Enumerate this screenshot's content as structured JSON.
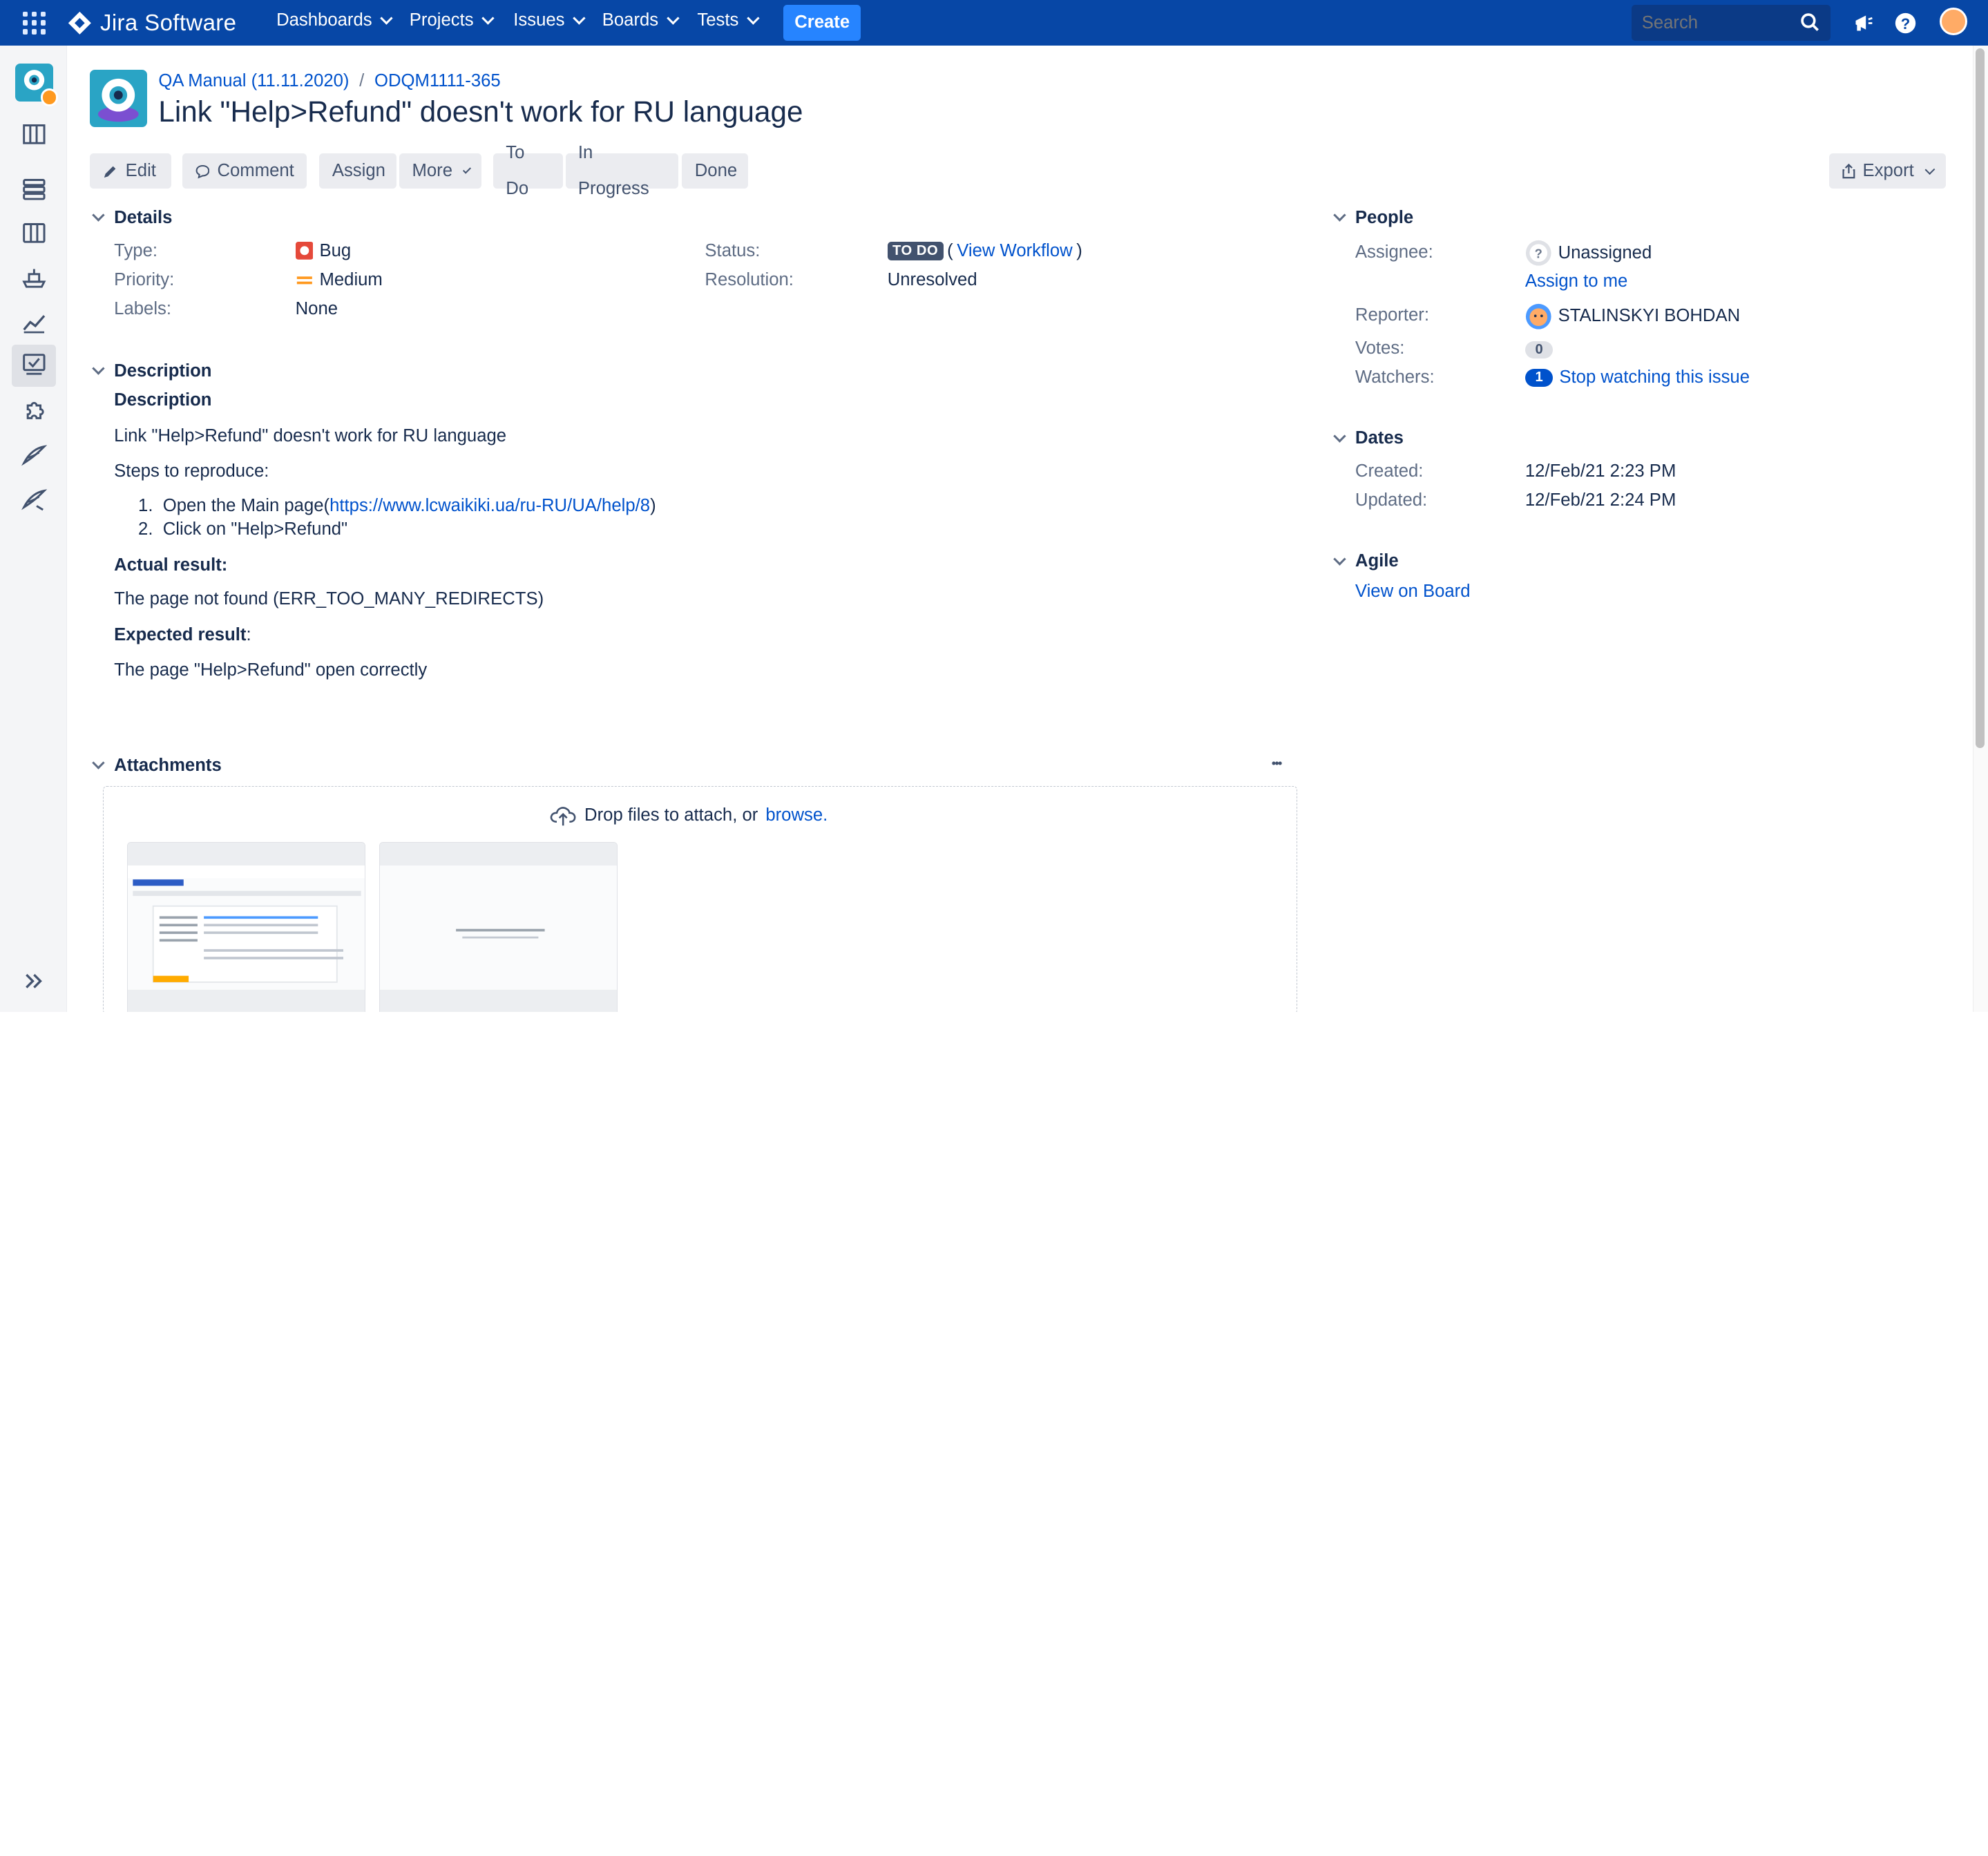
{
  "topbar": {
    "product": "Jira Software",
    "nav": [
      "Dashboards",
      "Projects",
      "Issues",
      "Boards",
      "Tests"
    ],
    "create_label": "Create",
    "search_placeholder": "Search"
  },
  "breadcrumb": {
    "project": "QA Manual (11.11.2020)",
    "issue_key": "ODQM1111-365"
  },
  "issue": {
    "title": "Link \"Help>Refund\" doesn't work for RU language"
  },
  "toolbar": {
    "edit": "Edit",
    "comment": "Comment",
    "assign": "Assign",
    "more": "More",
    "todo": "To Do",
    "in_progress": "In Progress",
    "done": "Done",
    "export": "Export"
  },
  "details": {
    "heading": "Details",
    "type_label": "Type:",
    "type_value": "Bug",
    "priority_label": "Priority:",
    "priority_value": "Medium",
    "labels_label": "Labels:",
    "labels_value": "None",
    "status_label": "Status:",
    "status_value": "TO DO",
    "view_workflow": "View Workflow",
    "resolution_label": "Resolution:",
    "resolution_value": "Unresolved"
  },
  "description": {
    "heading": "Description",
    "subheading": "Description",
    "line1": "Link \"Help>Refund\" doesn't work for RU language",
    "steps_label": "Steps to reproduce:",
    "step1_prefix": "Open the Main page(",
    "step1_link": "https://www.lcwaikiki.ua/ru-RU/UA/help/8",
    "step1_suffix": ")",
    "step2": "Click on \"Help>Refund\"",
    "actual_label": "Actual result:",
    "actual_value": "The page not found (ERR_TOO_MANY_REDIRECTS)",
    "expected_label": "Expected result",
    "expected_colon": ":",
    "expected_value": "The page \"Help>Refund\" open correctly"
  },
  "attachments": {
    "heading": "Attachments",
    "more": "•••",
    "drop_text": "Drop files to attach, or",
    "browse": "browse."
  },
  "people": {
    "heading": "People",
    "assignee_label": "Assignee:",
    "assignee_value": "Unassigned",
    "assign_to_me": "Assign to me",
    "reporter_label": "Reporter:",
    "reporter_value": "STALINSKYI BOHDAN",
    "votes_label": "Votes:",
    "votes_count": "0",
    "watchers_label": "Watchers:",
    "watchers_count": "1",
    "stop_watching": "Stop watching this issue"
  },
  "dates": {
    "heading": "Dates",
    "created_label": "Created:",
    "created_value": "12/Feb/21 2:23 PM",
    "updated_label": "Updated:",
    "updated_value": "12/Feb/21 2:24 PM"
  },
  "agile": {
    "heading": "Agile",
    "view_on_board": "View on Board"
  },
  "colors": {
    "topbar": "#0747a6",
    "create": "#2684ff",
    "link": "#0052cc",
    "bug": "#e5493a",
    "medium_priority": "#ff991f"
  }
}
